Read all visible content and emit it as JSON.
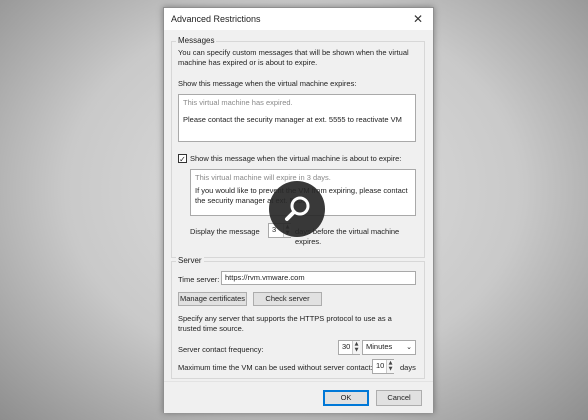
{
  "window": {
    "title": "Advanced Restrictions",
    "close_glyph": "✕"
  },
  "messages": {
    "group_label": "Messages",
    "description": "You can specify custom messages that will be shown when the virtual machine has expired or is about to expire.",
    "expires_label": "Show this message when the virtual machine expires:",
    "expires_line1": "This virtual machine has expired.",
    "expires_line2": "Please contact the security manager at ext. 5555 to reactivate VM",
    "about_checked": true,
    "about_label": "Show this message when the virtual machine is about to expire:",
    "about_line1": "This virtual machine will expire in 3 days.",
    "about_line2": "If you would like to prevent the VM from expiring, please contact the security manager at ext. 5555",
    "display_prefix": "Display the message",
    "display_days": "3",
    "display_suffix": "days before the virtual machine expires."
  },
  "server": {
    "group_label": "Server",
    "time_server_label": "Time server:",
    "time_server_value": "https://rvm.vmware.com",
    "manage_certs": "Manage certificates",
    "check_server": "Check server",
    "note": "Specify any server that supports the HTTPS protocol to use as a trusted time source.",
    "frequency_label": "Server contact frequency:",
    "frequency_value": "30",
    "frequency_unit": "Minutes",
    "max_time_label": "Maximum time the VM can be used without server contact:",
    "max_time_value": "10",
    "max_time_unit": "days"
  },
  "buttons": {
    "ok": "OK",
    "cancel": "Cancel"
  },
  "colors": {
    "accent": "#0078d7",
    "overlay": "#282828"
  }
}
